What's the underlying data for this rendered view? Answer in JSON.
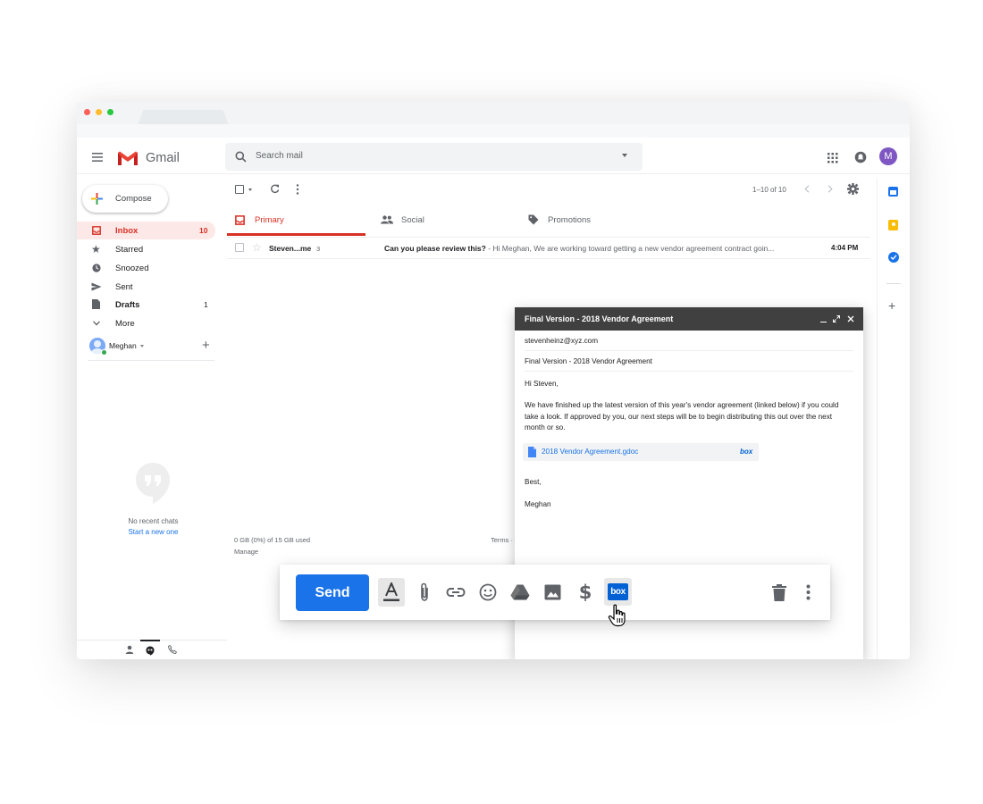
{
  "app": {
    "name": "Gmail",
    "avatar_initial": "M"
  },
  "search": {
    "placeholder": "Search mail"
  },
  "compose_button": {
    "label": "Compose"
  },
  "sidebar": {
    "items": [
      {
        "label": "Inbox",
        "count": "10",
        "icon": "inbox-icon",
        "active": true,
        "bold": true
      },
      {
        "label": "Starred",
        "count": "",
        "icon": "star-icon"
      },
      {
        "label": "Snoozed",
        "count": "",
        "icon": "clock-icon"
      },
      {
        "label": "Sent",
        "count": "",
        "icon": "send-icon"
      },
      {
        "label": "Drafts",
        "count": "1",
        "icon": "draft-icon",
        "bold": true
      },
      {
        "label": "More",
        "count": "",
        "icon": "chevron-down-icon"
      }
    ],
    "account": {
      "name": "Meghan"
    },
    "chat": {
      "empty_text": "No recent chats",
      "start_link": "Start a new one"
    }
  },
  "toolbar": {
    "pagination": "1–10 of 10"
  },
  "tabs": [
    {
      "label": "Primary",
      "icon": "inbox-icon",
      "active": true
    },
    {
      "label": "Social",
      "icon": "people-icon"
    },
    {
      "label": "Promotions",
      "icon": "tag-icon"
    }
  ],
  "emails": [
    {
      "sender": "Steven...me",
      "thread_count": "3",
      "subject": "Can you please review this?",
      "snippet": " - Hi Meghan, We are working toward getting a new vendor agreement contract goin...",
      "time": "4:04 PM"
    }
  ],
  "footer": {
    "storage": "0 GB (0%) of 15 GB used",
    "manage": "Manage",
    "terms": "Terms ·"
  },
  "compose_window": {
    "title": "Final Version - 2018 Vendor Agreement",
    "to": "stevenheinz@xyz.com",
    "subject": "Final Version - 2018 Vendor Agreement",
    "greeting": "Hi Steven,",
    "body_lines": [
      "We have finished up the latest version of this year's vendor agreement (linked below) if you could",
      "take a look. If approved by you, our next steps will be to begin distributing this out over the next",
      "month or so."
    ],
    "attachment": {
      "name": "2018 Vendor Agreement.gdoc",
      "provider": "box"
    },
    "closing": "Best,",
    "signature": "Meghan"
  },
  "compose_toolbar": {
    "send_label": "Send",
    "icons": [
      "format-text-icon",
      "attach-icon",
      "link-icon",
      "emoji-icon",
      "drive-icon",
      "photo-icon",
      "money-icon",
      "box-icon",
      "trash-icon",
      "more-icon"
    ],
    "box_label": "box"
  },
  "colors": {
    "accent": "#1a73e8",
    "inbox_red": "#d93025",
    "compose_header": "#404040",
    "send": "#1a73e8"
  }
}
